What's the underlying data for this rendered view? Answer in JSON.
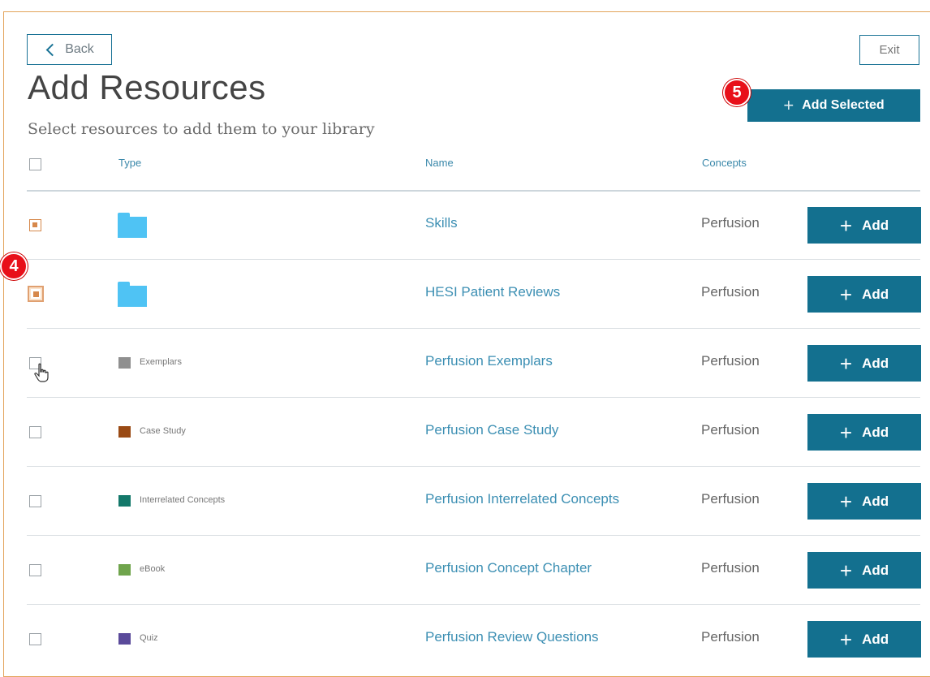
{
  "header": {
    "back_label": "Back",
    "exit_label": "Exit",
    "title": "Add Resources",
    "subtitle": "Select resources to add them to your library",
    "add_selected_label": "Add Selected",
    "marker_add_selected": "5",
    "marker_rows": "4"
  },
  "table": {
    "columns": [
      "Type",
      "Name",
      "Concepts"
    ],
    "add_label": "Add",
    "rows": [
      {
        "type": "",
        "type_icon": "folder-icon",
        "type_color": "#4fc3f4",
        "name": "Skills",
        "concept": "Perfusion",
        "checked": true
      },
      {
        "type": "",
        "type_icon": "folder-icon",
        "type_color": "#4fc3f4",
        "name": "HESI Patient Reviews",
        "concept": "Perfusion",
        "checked": true
      },
      {
        "type": "Exemplars",
        "type_icon": "square-swatch",
        "type_color": "#8f8f8f",
        "name": "Perfusion Exemplars",
        "concept": "Perfusion",
        "checked": false
      },
      {
        "type": "Case Study",
        "type_icon": "square-swatch",
        "type_color": "#9a4a14",
        "name": "Perfusion Case Study",
        "concept": "Perfusion",
        "checked": false
      },
      {
        "type": "Interrelated Concepts",
        "type_icon": "square-swatch",
        "type_color": "#13786a",
        "name": "Perfusion Interrelated Concepts",
        "concept": "Perfusion",
        "checked": false
      },
      {
        "type": "eBook",
        "type_icon": "square-swatch",
        "type_color": "#6fa44c",
        "name": "Perfusion Concept Chapter",
        "concept": "Perfusion",
        "checked": false
      },
      {
        "type": "Quiz",
        "type_icon": "square-swatch",
        "type_color": "#5a4a9a",
        "name": "Perfusion Review Questions",
        "concept": "Perfusion",
        "checked": false
      }
    ]
  },
  "colors": {
    "accent": "#13708f",
    "link": "#3c8fb3",
    "frame_border": "#e3a35a",
    "marker": "#e8101a"
  }
}
